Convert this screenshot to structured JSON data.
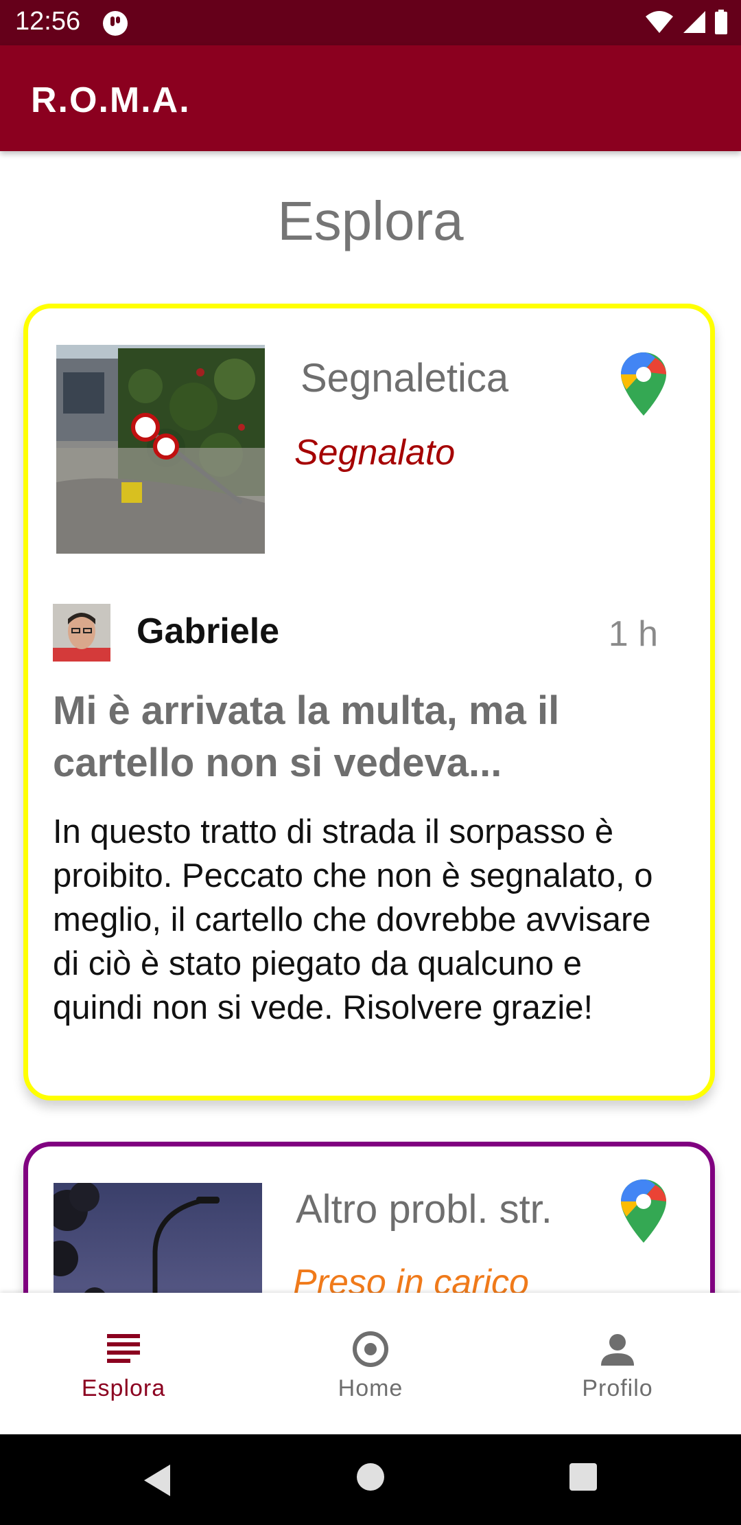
{
  "status_bar": {
    "time": "12:56"
  },
  "app_bar": {
    "title": "R.O.M.A."
  },
  "page": {
    "title": "Esplora"
  },
  "reports": [
    {
      "category": "Segnaletica",
      "status": "Segnalato",
      "author": "Gabriele",
      "time_ago": "1 h",
      "title": "Mi è arrivata la multa, ma il cartello non si vedeva...",
      "body": "In questo tratto di strada il sorpasso è proibito. Peccato che non è segnalato, o meglio, il cartello che dovrebbe avvisare di ciò è stato piegato da qualcuno e quindi non si vede. Risolvere grazie!",
      "border_color": "#ffff00",
      "status_color": "#a50000"
    },
    {
      "category": "Altro probl. str.",
      "status": "Preso in carico",
      "border_color": "#800080",
      "status_color": "#f07a1a"
    }
  ],
  "bottom_nav": {
    "items": [
      {
        "label": "Esplora",
        "icon": "list-icon",
        "active": true
      },
      {
        "label": "Home",
        "icon": "location-icon",
        "active": false
      },
      {
        "label": "Profilo",
        "icon": "person-icon",
        "active": false
      }
    ]
  },
  "colors": {
    "status_bar": "#65001a",
    "app_bar": "#8b001f",
    "accent": "#8b001f"
  }
}
